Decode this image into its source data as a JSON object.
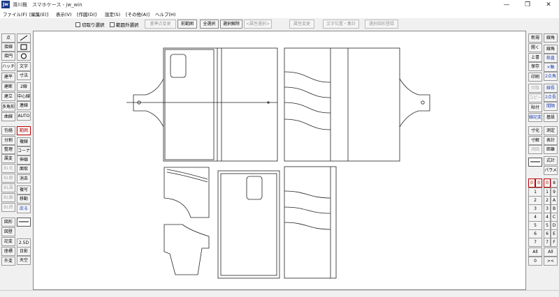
{
  "window": {
    "app_icon": "Jw",
    "title": "滑川稚　スマホケース - jw_win",
    "minimize": "—",
    "restore": "❐",
    "close": "✕"
  },
  "menu": [
    "ファイル(F)",
    "[編集(E)]",
    "表示(V)",
    "[作図(D)]",
    "設定(S)",
    "[その他(A)]",
    "ヘルプ(H)"
  ],
  "toolbar": {
    "checkbox_cut_select": "切取り選択",
    "checkbox_outside_select": "範囲外選択",
    "btn_base_change": "基準点変更",
    "btn_prev_range": "前範囲",
    "btn_select_all": "全選択",
    "btn_deselect": "選択解除",
    "btn_attr_select": "<属性選択>",
    "btn_attr_change": "属性変更",
    "btn_text_pos": "文字位置・集計",
    "btn_register_shape": "選択図形登録"
  },
  "left_panel": {
    "col1": [
      "点",
      "接線",
      "接円",
      "ハッチ",
      "建平",
      "建断",
      "建立",
      "多角形",
      "曲線",
      "包絡",
      "分割",
      "整理",
      "属変",
      "BL化",
      "BL解",
      "BL属",
      "BL編",
      "BL終",
      "図形",
      "図登",
      "記変",
      "座標",
      "外変"
    ],
    "col2_top_icons": [
      "line-icon",
      "rectangle-icon",
      "circle-icon"
    ],
    "col2": [
      "文字",
      "寸法",
      "2線",
      "中心線",
      "連線",
      "AUTO",
      "範囲",
      "複線",
      "コーナー",
      "伸縮",
      "面取",
      "消去",
      "複写",
      "移動",
      "戻る",
      "2.5D",
      "日影",
      "天空"
    ]
  },
  "right_panel": {
    "col1": [
      "新規",
      "開く",
      "上書",
      "保存",
      "印刷",
      "切取",
      "コピー",
      "貼付",
      "線記変",
      "寸化",
      "寸解",
      "測図"
    ],
    "col2": [
      "線角",
      "鉛直",
      "×軸",
      "2点角",
      "線長",
      "2点長",
      "間隔",
      "基設",
      "測定",
      "表計",
      "距離",
      "式計",
      "パラメ"
    ],
    "layer_groups": [
      "0",
      "1",
      "2",
      "3",
      "4",
      "5",
      "6",
      "7"
    ],
    "layers": [
      "0",
      "8",
      "1",
      "9",
      "2",
      "A",
      "3",
      "B",
      "4",
      "C",
      "5",
      "D",
      "6",
      "E",
      "7",
      "F"
    ],
    "all_label_1": "All",
    "all_label_2": "All",
    "zero_label": "0",
    "extra_label": "><"
  },
  "colors": {
    "active_red": "#c00000",
    "blue_text": "#1a3fb0",
    "line": "#222222"
  }
}
